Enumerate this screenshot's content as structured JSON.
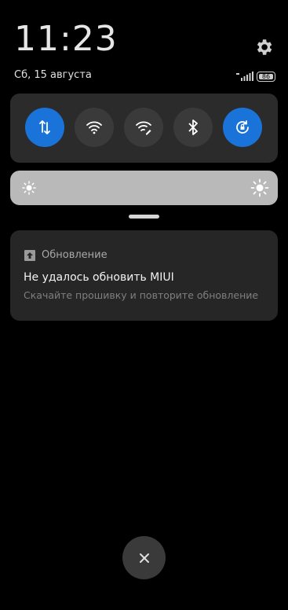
{
  "status": {
    "time": "11:23",
    "date": "Сб, 15 августа",
    "battery": "86",
    "icons": [
      "signal-icon",
      "battery-icon"
    ]
  },
  "quick_settings": {
    "toggles": [
      {
        "name": "mobile-data",
        "icon": "data-arrows-icon",
        "on": true
      },
      {
        "name": "wifi",
        "icon": "wifi-icon",
        "on": false
      },
      {
        "name": "wifi-hotspot",
        "icon": "wifi-edit-icon",
        "on": false
      },
      {
        "name": "bluetooth",
        "icon": "bluetooth-icon",
        "on": false
      },
      {
        "name": "rotation-lock",
        "icon": "rotation-lock-icon",
        "on": true
      }
    ],
    "accent": "#1a73d9"
  },
  "brightness": {
    "icons": [
      "sun-low-icon",
      "sun-high-icon"
    ]
  },
  "notification": {
    "app": "Обновление",
    "title": "Не удалось обновить MIUI",
    "text": "Скачайте прошивку и повторите обновление"
  },
  "controls": {
    "close_icon": "close-icon"
  }
}
